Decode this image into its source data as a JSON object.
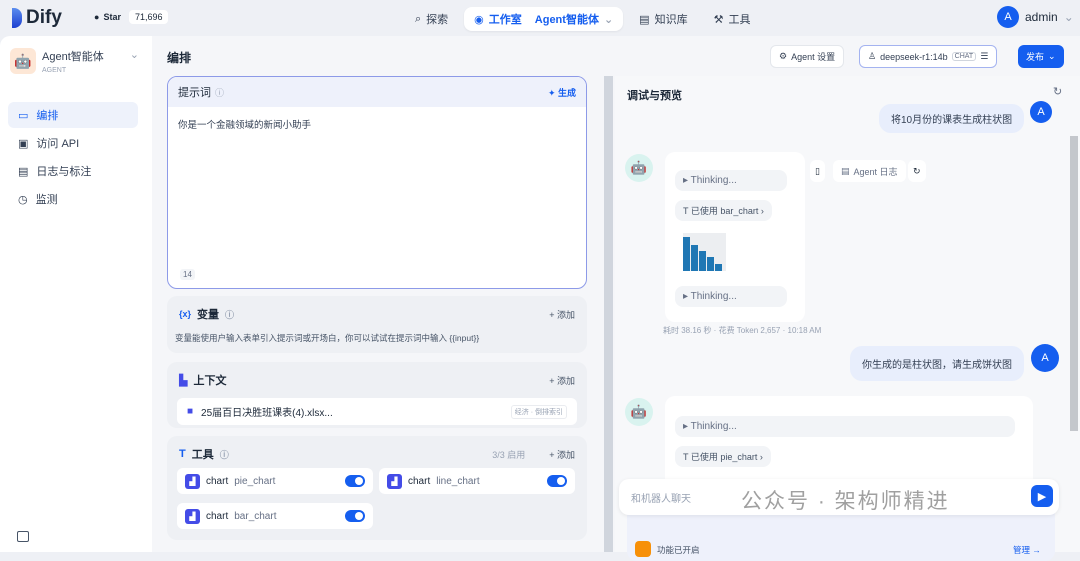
{
  "header": {
    "brand": "Dify",
    "github_star_label": "Star",
    "github_stars": "71,696",
    "nav": [
      {
        "label": "探索"
      },
      {
        "label": "工作室"
      },
      {
        "label": "Agent智能体"
      },
      {
        "label": "知识库"
      },
      {
        "label": "工具"
      }
    ],
    "user": {
      "avatar": "A",
      "name": "admin"
    }
  },
  "sidebar": {
    "app_name": "Agent智能体",
    "app_type": "AGENT",
    "items": [
      {
        "label": "编排"
      },
      {
        "label": "访问 API"
      },
      {
        "label": "日志与标注"
      },
      {
        "label": "监测"
      }
    ]
  },
  "editor": {
    "title": "编排",
    "agent_settings": "Agent 设置",
    "model": "deepseek-r1:14b",
    "model_badge": "CHAT",
    "publish": "发布",
    "prompt": {
      "label": "提示词",
      "generate": "生成",
      "text": "你是一个金融领域的新闻小助手",
      "count": "14"
    },
    "variables": {
      "label": "变量",
      "add": "添加",
      "hint": "变量能使用户输入表单引入提示词或开场白，你可以试试在提示词中输入 {{input}}"
    },
    "context": {
      "label": "上下文",
      "add": "添加",
      "file": "25届百日决胜班课表(4).xlsx...",
      "file_tag": "经济 · 倒排索引"
    },
    "tools": {
      "label": "工具",
      "enabled": "3/3 启用",
      "add": "添加",
      "items": [
        {
          "provider": "chart",
          "name": "pie_chart"
        },
        {
          "provider": "chart",
          "name": "line_chart"
        },
        {
          "provider": "chart",
          "name": "bar_chart"
        }
      ]
    }
  },
  "preview": {
    "title": "调试与预览",
    "msg1": "将10月份的课表生成柱状图",
    "thinking": "Thinking...",
    "used1": "已使用 bar_chart",
    "agent_log": "Agent 日志",
    "meta": "耗时 38.16 秒 · 花费 Token 2,657 · 10:18 AM",
    "msg2": "你生成的是柱状图，请生成饼状图",
    "used2": "已使用 pie_chart",
    "input_placeholder": "和机器人聊天",
    "feature": "功能已开启",
    "manage": "管理 →",
    "user_avatar": "A"
  },
  "watermark": "公众号 · 架构师精进",
  "colors": {
    "accent": "#155eef",
    "tool_icon": "#444ce7"
  }
}
